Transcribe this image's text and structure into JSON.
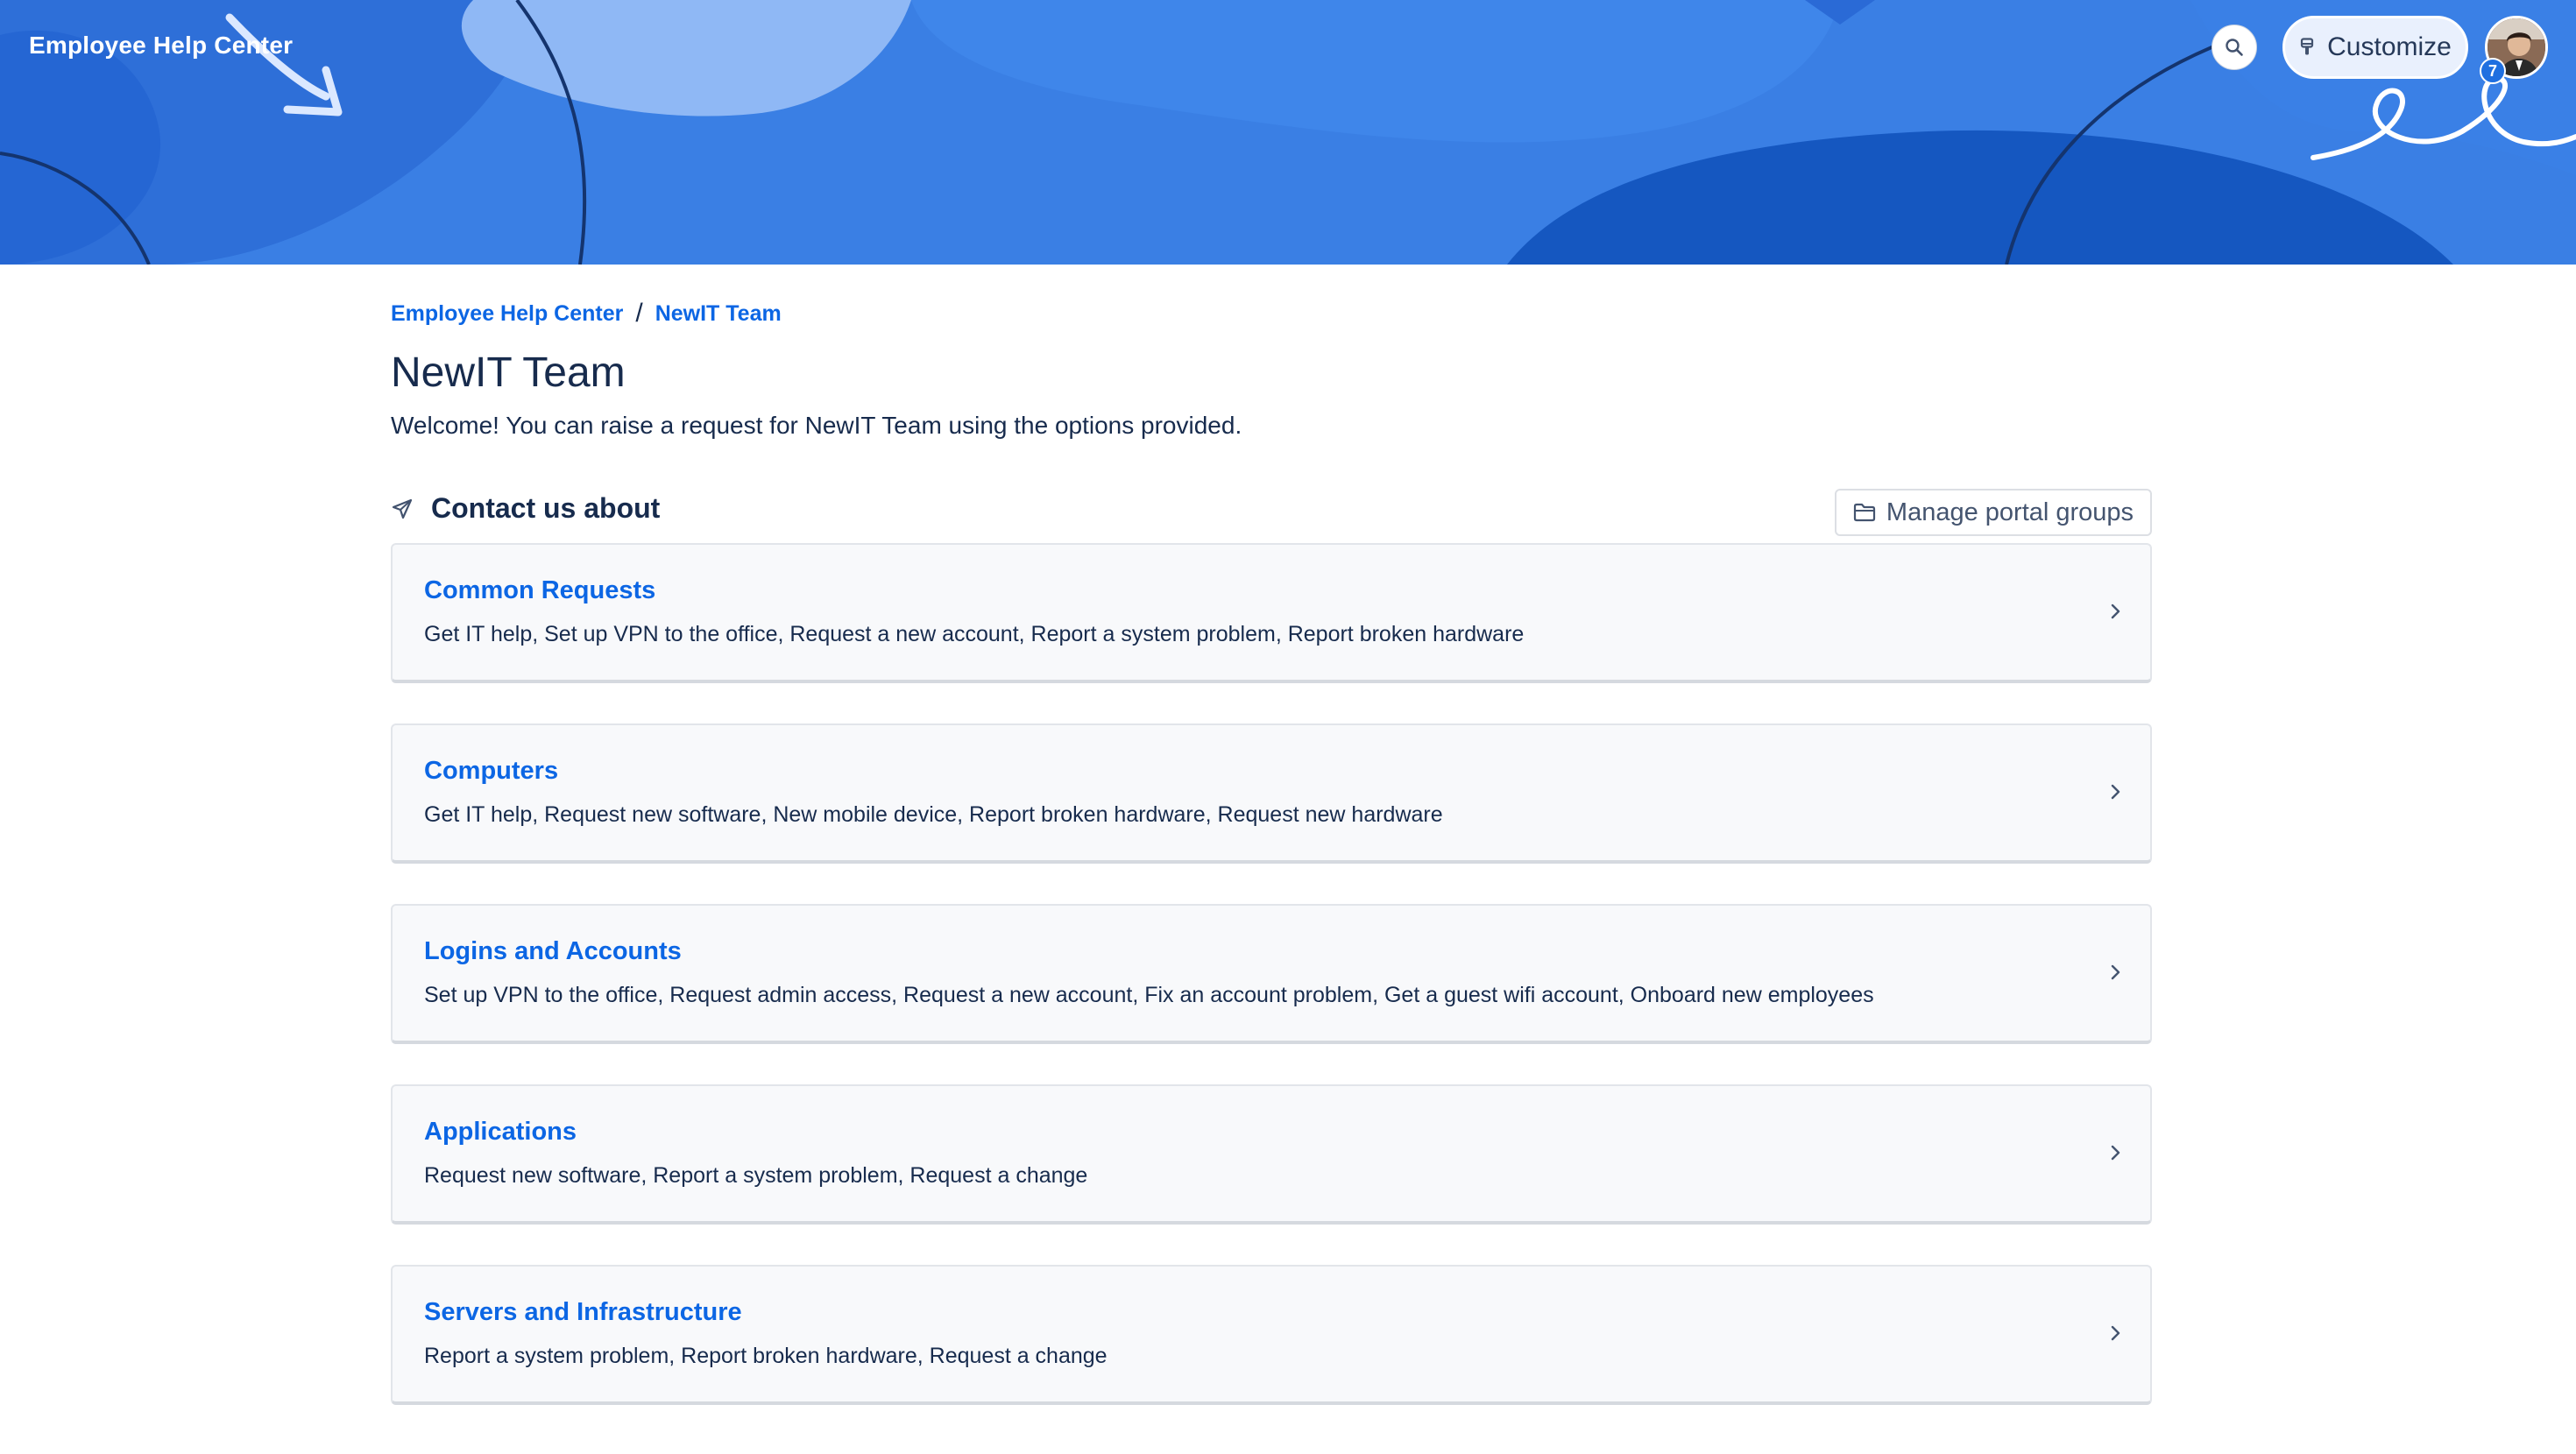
{
  "header": {
    "site_title": "Employee Help Center",
    "customize_label": "Customize",
    "notification_count": "7",
    "colors": {
      "banner": "#3a7fe4",
      "banner_dark": "#1557c0",
      "link": "#0c66e4"
    }
  },
  "breadcrumb": {
    "items": [
      {
        "label": "Employee Help Center"
      },
      {
        "label": "NewIT Team"
      }
    ],
    "separator": "/"
  },
  "page": {
    "title": "NewIT Team",
    "intro": "Welcome! You can raise a request for NewIT Team using the options provided."
  },
  "section": {
    "title": "Contact us about",
    "manage_label": "Manage portal groups"
  },
  "groups": [
    {
      "title": "Common Requests",
      "description": "Get IT help, Set up VPN to the office, Request a new account, Report a system problem, Report broken hardware"
    },
    {
      "title": "Computers",
      "description": "Get IT help, Request new software, New mobile device, Report broken hardware, Request new hardware"
    },
    {
      "title": "Logins and Accounts",
      "description": "Set up VPN to the office, Request admin access, Request a new account, Fix an account problem, Get a guest wifi account, Onboard new employees"
    },
    {
      "title": "Applications",
      "description": "Request new software, Report a system problem, Request a change"
    },
    {
      "title": "Servers and Infrastructure",
      "description": "Report a system problem, Report broken hardware, Request a change"
    }
  ],
  "icons": {
    "search": "search-icon",
    "customize": "paintbrush-icon",
    "send": "paper-plane-icon",
    "folder": "folder-icon",
    "chevron": "chevron-right-icon"
  }
}
